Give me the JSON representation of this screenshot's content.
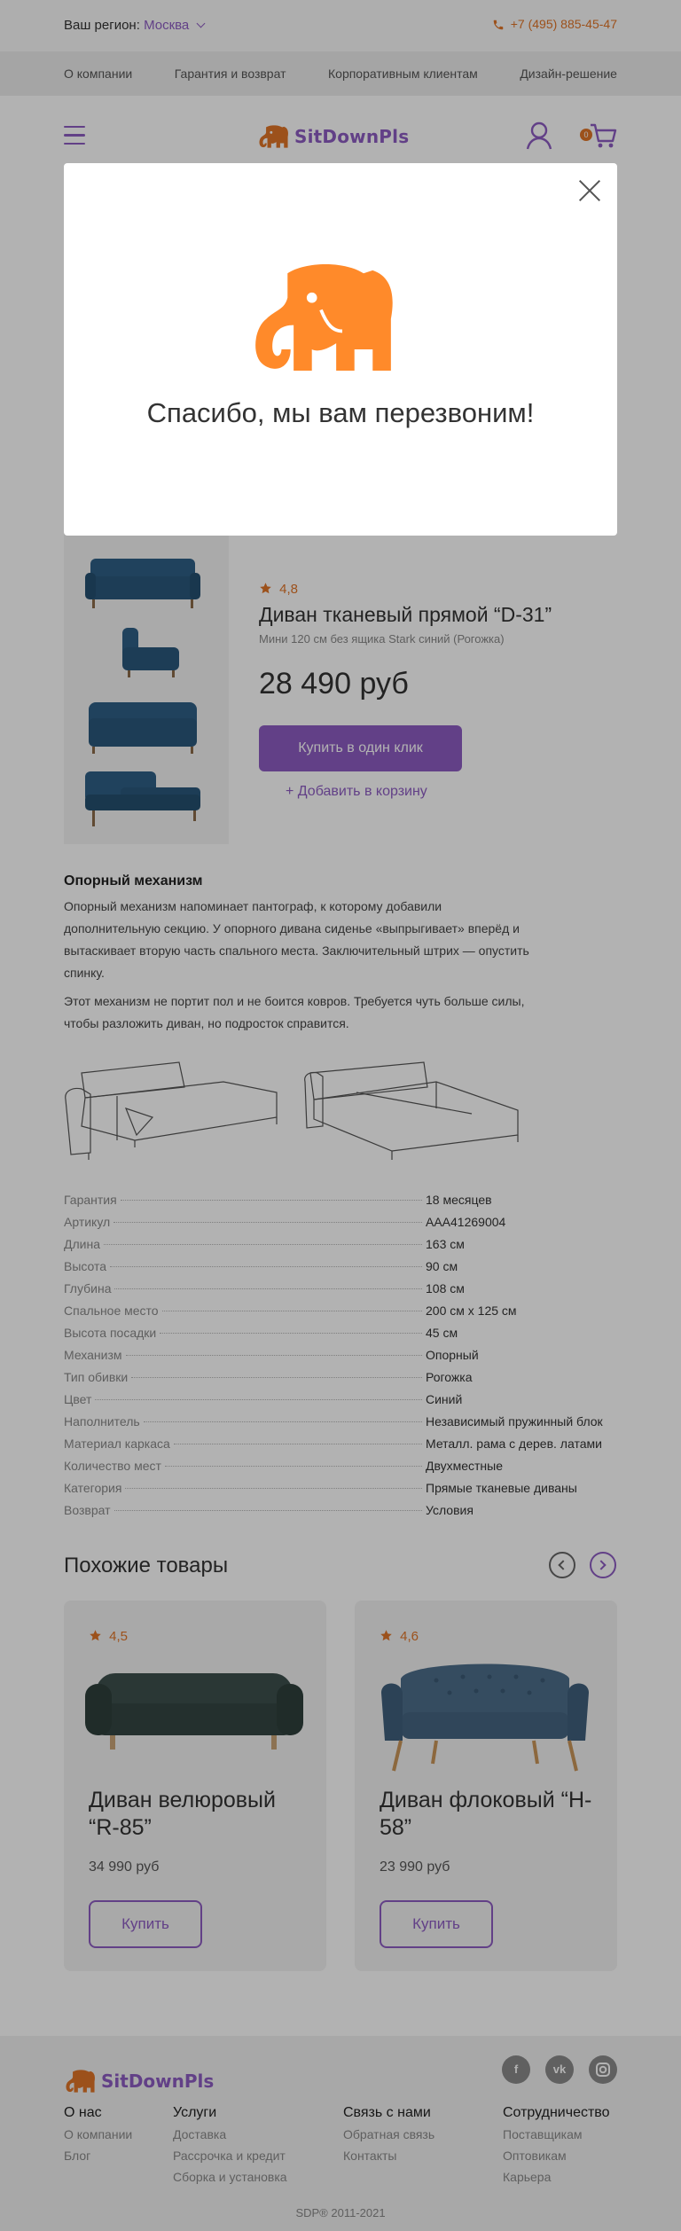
{
  "topbar": {
    "region_label": "Ваш регион:",
    "city": "Москва",
    "phone": "+7 (495) 885-45-47"
  },
  "nav": {
    "links": [
      "О компании",
      "Гарантия и возврат",
      "Корпоративным клиентам",
      "Дизайн-решение"
    ]
  },
  "header": {
    "logo_text": "SitDownPls",
    "cart_count": "0"
  },
  "product": {
    "rating": "4,8",
    "title": "Диван тканевый прямой “D-31”",
    "subtitle": "Мини 120 см без ящика Stark синий (Рогожка)",
    "price": "28 490 руб",
    "buy_button": "Купить в один клик",
    "add_to_cart": "+ Добавить в корзину"
  },
  "description": {
    "title": "Опорный механизм",
    "paragraph1": "Опорный механизм напоминает пантограф, к которому добавили дополнительную секцию. У опорного дивана сиденье «выпрыгивает» вперёд и вытаскивает вторую часть спального места. Заключительный штрих — опустить спинку.",
    "paragraph2": "Этот механизм не портит пол и не боится ковров. Требуется чуть больше силы, чтобы разложить диван, но подросток справится."
  },
  "specs": [
    {
      "key": "Гарантия",
      "value": "18 месяцев"
    },
    {
      "key": "Артикул",
      "value": "AAA41269004"
    },
    {
      "key": "Длина",
      "value": "163 см"
    },
    {
      "key": "Высота",
      "value": "90 см"
    },
    {
      "key": "Глубина",
      "value": "108 см"
    },
    {
      "key": "Спальное место",
      "value": "200 см х 125 см"
    },
    {
      "key": "Высота посадки",
      "value": "45 см"
    },
    {
      "key": "Механизм",
      "value": "Опорный"
    },
    {
      "key": "Тип обивки",
      "value": "Рогожка"
    },
    {
      "key": "Цвет",
      "value": "Синий"
    },
    {
      "key": "Наполнитель",
      "value": "Независимый пружинный блок"
    },
    {
      "key": "Материал каркаса",
      "value": "Металл. рама с дерев. латами"
    },
    {
      "key": "Количество мест",
      "value": "Двухместные"
    },
    {
      "key": "Категория",
      "value": "Прямые тканевые диваны"
    },
    {
      "key": "Возврат",
      "value": "Условия"
    }
  ],
  "similar": {
    "title": "Похожие товары",
    "items": [
      {
        "rating": "4,5",
        "name": "Диван велюровый “R-85”",
        "price": "34 990 руб",
        "buy": "Купить"
      },
      {
        "rating": "4,6",
        "name": "Диван флоковый “H-58”",
        "price": "23 990 руб",
        "buy": "Купить"
      }
    ]
  },
  "footer": {
    "logo_text": "SitDownPls",
    "social": [
      "fb",
      "vk",
      "ig"
    ],
    "columns": [
      {
        "title": "О нас",
        "links": [
          "О компании",
          "Блог"
        ]
      },
      {
        "title": "Услуги",
        "links": [
          "Доставка",
          "Рассрочка и кредит",
          "Сборка и установка"
        ]
      },
      {
        "title": "Связь с нами",
        "links": [
          "Обратная связь",
          "Контакты"
        ]
      },
      {
        "title": "Сотрудничество",
        "links": [
          "Поставщикам",
          "Оптовикам",
          "Карьера"
        ]
      }
    ],
    "copyright": "SDP®   2011-2021"
  },
  "modal": {
    "message": "Спасибо, мы вам перезвоним!"
  },
  "colors": {
    "accent": "#8d5cc2",
    "orange": "#e07428",
    "sofa_blue": "#2f5f86"
  },
  "icons": [
    "phone-icon",
    "chevron-down-icon",
    "burger-icon",
    "user-icon",
    "cart-icon",
    "star-icon",
    "close-icon",
    "elephant-logo-icon",
    "arrow-left-icon",
    "arrow-right-icon"
  ]
}
